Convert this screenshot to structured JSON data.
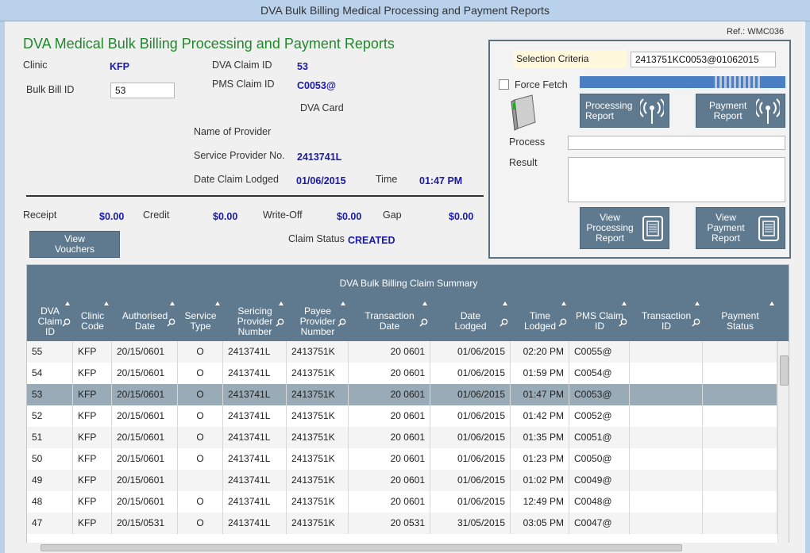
{
  "window": {
    "title": "DVA  Bulk Billing  Medical Processing and Payment Reports"
  },
  "ref": "Ref.: WMC036",
  "heading": "DVA  Medical Bulk Billing Processing and Payment Reports",
  "clinic": {
    "label": "Clinic",
    "value": "KFP"
  },
  "bulk_bill": {
    "label": "Bulk Bill ID",
    "value": "53"
  },
  "dva_claim": {
    "label": "DVA Claim ID",
    "value": "53"
  },
  "pms_claim": {
    "label": "PMS Claim ID",
    "value": "C0053@"
  },
  "dva_card": {
    "label": "DVA Card"
  },
  "provider_name": {
    "label": "Name of Provider"
  },
  "service_provider": {
    "label": "Service Provider No.",
    "value": "2413741L"
  },
  "date_lodged": {
    "label": "Date Claim Lodged",
    "value": "01/06/2015",
    "time_label": "Time",
    "time_value": "01:47 PM"
  },
  "amounts": {
    "receipt_label": "Receipt",
    "receipt": "$0.00",
    "credit_label": "Credit",
    "credit": "$0.00",
    "writeoff_label": "Write-Off",
    "writeoff": "$0.00",
    "gap_label": "Gap",
    "gap": "$0.00"
  },
  "view_vouchers": "View\nVouchers",
  "claim_status": {
    "label": "Claim Status",
    "value": "CREATED"
  },
  "panel": {
    "selection_label": "Selection Criteria",
    "selection_value": "2413751KC0053@01062015",
    "force_fetch": "Force Fetch",
    "processing_report": "Processing\nReport",
    "payment_report": "Payment\nReport",
    "process_label": "Process",
    "result_label": "Result",
    "view_processing": "View\nProcessing\nReport",
    "view_payment": "View\nPayment\nReport"
  },
  "grid": {
    "title": "DVA Bulk Billing Claim Summary",
    "columns": [
      "DVA\nClaim\nID",
      "Clinic\nCode",
      "Authorised\nDate",
      "Service\nType",
      "Sericing\nProvider\nNumber",
      "Payee\nProvider\nNumber",
      "Transaction\nDate",
      "Date\nLodged",
      "Time\nLodged",
      "PMS Claim\nID",
      "Transaction\nID",
      "Payment\nStatus"
    ],
    "rows": [
      [
        "55",
        "KFP",
        "20/15/0601",
        "O",
        "2413741L",
        "2413751K",
        "20  0601",
        "01/06/2015",
        "02:20 PM",
        "C0055@",
        "",
        ""
      ],
      [
        "54",
        "KFP",
        "20/15/0601",
        "O",
        "2413741L",
        "2413751K",
        "20  0601",
        "01/06/2015",
        "01:59 PM",
        "C0054@",
        "",
        ""
      ],
      [
        "53",
        "KFP",
        "20/15/0601",
        "O",
        "2413741L",
        "2413751K",
        "20  0601",
        "01/06/2015",
        "01:47 PM",
        "C0053@",
        "",
        ""
      ],
      [
        "52",
        "KFP",
        "20/15/0601",
        "O",
        "2413741L",
        "2413751K",
        "20  0601",
        "01/06/2015",
        "01:42 PM",
        "C0052@",
        "",
        ""
      ],
      [
        "51",
        "KFP",
        "20/15/0601",
        "O",
        "2413741L",
        "2413751K",
        "20  0601",
        "01/06/2015",
        "01:35 PM",
        "C0051@",
        "",
        ""
      ],
      [
        "50",
        "KFP",
        "20/15/0601",
        "O",
        "2413741L",
        "2413751K",
        "20  0601",
        "01/06/2015",
        "01:23 PM",
        "C0050@",
        "",
        ""
      ],
      [
        "49",
        "KFP",
        "20/15/0601",
        "",
        "2413741L",
        "2413751K",
        "20  0601",
        "01/06/2015",
        "01:02 PM",
        "C0049@",
        "",
        ""
      ],
      [
        "48",
        "KFP",
        "20/15/0601",
        "O",
        "2413741L",
        "2413751K",
        "20  0601",
        "01/06/2015",
        "12:49 PM",
        "C0048@",
        "",
        ""
      ],
      [
        "47",
        "KFP",
        "20/15/0531",
        "O",
        "2413741L",
        "2413751K",
        "20  0531",
        "31/05/2015",
        "03:05 PM",
        "C0047@",
        "",
        ""
      ]
    ]
  }
}
